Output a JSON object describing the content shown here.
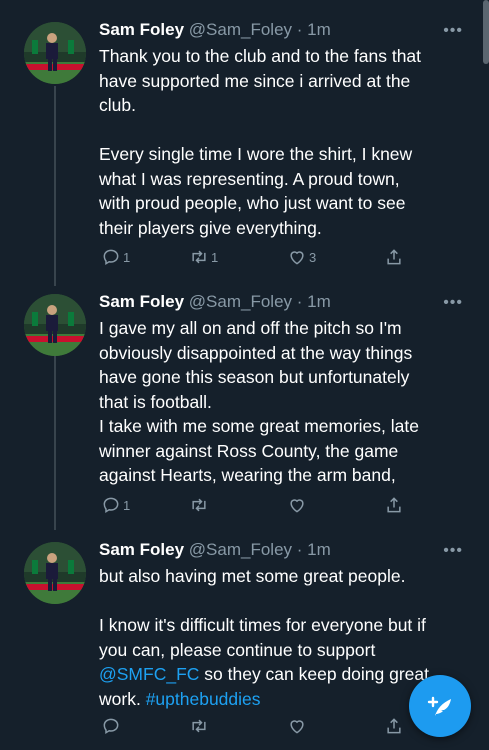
{
  "tweets": [
    {
      "name": "Sam Foley",
      "handle": "@Sam_Foley",
      "time": "· 1m",
      "more": "•••",
      "lines": [
        "Thank you to the club and to the fans that",
        "have supported me since i arrived at the",
        "club.",
        "",
        "Every single time I wore the shirt, I knew",
        "what I was representing. A proud town,",
        "with proud people, who just want to see",
        "their players give everything."
      ],
      "replies": "1",
      "retweets": "1",
      "likes": "3"
    },
    {
      "name": "Sam Foley",
      "handle": "@Sam_Foley",
      "time": "· 1m",
      "more": "•••",
      "lines": [
        "I gave my all on and off the pitch so I'm",
        "obviously disappointed at the way things",
        "have gone this season but unfortunately",
        "that is football.",
        "I take with me some great memories, late",
        "winner against Ross County, the game",
        "against Hearts, wearing the arm band,"
      ],
      "replies": "1",
      "retweets": "",
      "likes": ""
    },
    {
      "name": "Sam Foley",
      "handle": "@Sam_Foley",
      "time": "· 1m",
      "more": "•••",
      "line1": "but also having met some great people.",
      "line2": "I know it's difficult times for everyone but if",
      "line3": "you can, please continue to support",
      "mention": "@SMFC_FC",
      "line4_rest": " so they can keep doing great",
      "line5_pre": "work. ",
      "hashtag": "#upthebuddies",
      "replies": "",
      "retweets": "",
      "likes": ""
    }
  ],
  "colors": {
    "background": "#15202b",
    "accent": "#1d9bf0",
    "muted": "#8899a6"
  },
  "fab": {
    "icon": "compose-tweet-icon"
  }
}
